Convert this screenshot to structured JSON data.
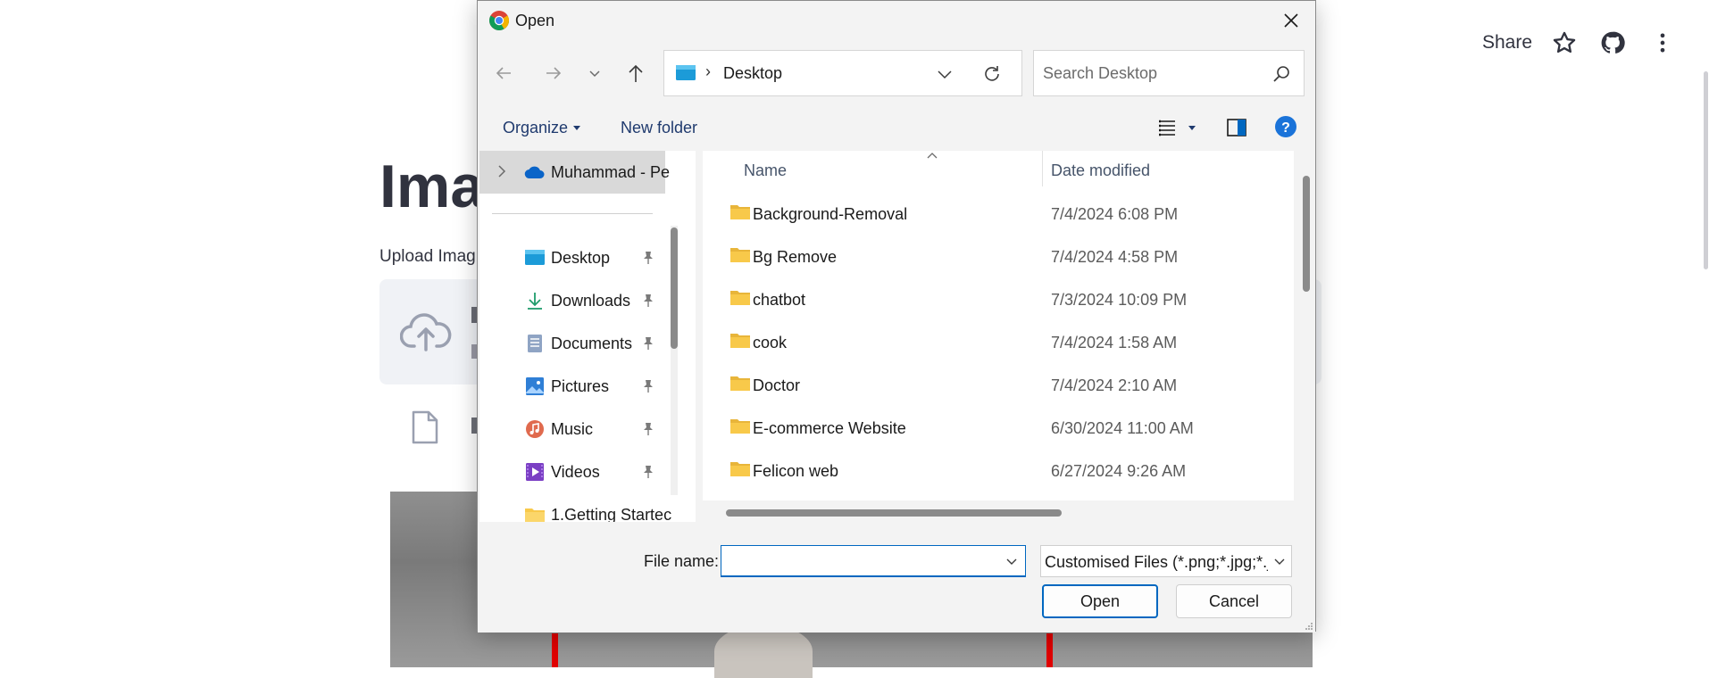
{
  "background": {
    "share_label": "Share",
    "title_visible": "Ima",
    "upload_label_visible": "Upload Imag"
  },
  "dialog": {
    "title": "Open",
    "address": {
      "location": "Desktop"
    },
    "search": {
      "placeholder": "Search Desktop"
    },
    "toolbar": {
      "organize_label": "Organize",
      "new_folder_label": "New folder"
    },
    "nav": {
      "onedrive_label": "Muhammad - Pe",
      "items": [
        {
          "label": "Desktop",
          "icon": "desktop-icon",
          "pinned": true
        },
        {
          "label": "Downloads",
          "icon": "download-icon",
          "pinned": true
        },
        {
          "label": "Documents",
          "icon": "documents-icon",
          "pinned": true
        },
        {
          "label": "Pictures",
          "icon": "pictures-icon",
          "pinned": true
        },
        {
          "label": "Music",
          "icon": "music-icon",
          "pinned": true
        },
        {
          "label": "Videos",
          "icon": "videos-icon",
          "pinned": true
        },
        {
          "label": "1.Getting Startec",
          "icon": "folder-icon",
          "pinned": false
        }
      ]
    },
    "columns": {
      "name": "Name",
      "date": "Date modified"
    },
    "files": [
      {
        "name": "Background-Removal",
        "date": "7/4/2024 6:08 PM"
      },
      {
        "name": "Bg Remove",
        "date": "7/4/2024 4:58 PM"
      },
      {
        "name": "chatbot",
        "date": "7/3/2024 10:09 PM"
      },
      {
        "name": "cook",
        "date": "7/4/2024 1:58 AM"
      },
      {
        "name": "Doctor",
        "date": "7/4/2024 2:10 AM"
      },
      {
        "name": "E-commerce Website",
        "date": "6/30/2024 11:00 AM"
      },
      {
        "name": "Felicon web",
        "date": "6/27/2024 9:26 AM"
      }
    ],
    "file_name_label": "File name:",
    "file_name_value": "",
    "file_type": "Customised Files (*.png;*.jpg;*.j",
    "open_label": "Open",
    "cancel_label": "Cancel"
  },
  "colors": {
    "accent": "#0067c0",
    "folder_yellow": "#f8c94a",
    "nav_selected": "#d9d9d9",
    "dialog_bg": "#f3f3f3"
  }
}
